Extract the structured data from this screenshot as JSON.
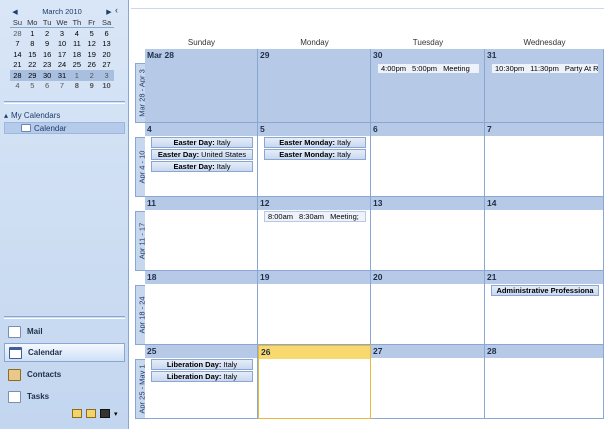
{
  "minical": {
    "title": "March 2010",
    "prev_icon": "◀",
    "next_icon": "▶",
    "dow": [
      "Su",
      "Mo",
      "Tu",
      "We",
      "Th",
      "Fr",
      "Sa"
    ],
    "weeks": [
      [
        "28",
        "1",
        "2",
        "3",
        "4",
        "5",
        "6"
      ],
      [
        "7",
        "8",
        "9",
        "10",
        "11",
        "12",
        "13"
      ],
      [
        "14",
        "15",
        "16",
        "17",
        "18",
        "19",
        "20"
      ],
      [
        "21",
        "22",
        "23",
        "24",
        "25",
        "26",
        "27"
      ],
      [
        "28",
        "29",
        "30",
        "31",
        "1",
        "2",
        "3"
      ],
      [
        "4",
        "5",
        "6",
        "7",
        "8",
        "9",
        "10"
      ]
    ]
  },
  "collapse_icon": "‹",
  "my_calendars": {
    "label": "My Calendars",
    "toggle_icon": "▴",
    "item": "Calendar"
  },
  "nav": {
    "mail": "Mail",
    "calendar": "Calendar",
    "contacts": "Contacts",
    "tasks": "Tasks"
  },
  "days": [
    "Sunday",
    "Monday",
    "Tuesday",
    "Wednesday"
  ],
  "weeks": [
    {
      "label": "Mar 28 - Apr 3",
      "dates": [
        "Mar 28",
        "29",
        "30",
        "31"
      ]
    },
    {
      "label": "Apr 4 - 10",
      "dates": [
        "4",
        "5",
        "6",
        "7"
      ]
    },
    {
      "label": "Apr 11 - 17",
      "dates": [
        "11",
        "12",
        "13",
        "14"
      ]
    },
    {
      "label": "Apr 18 - 24",
      "dates": [
        "18",
        "19",
        "20",
        "21"
      ]
    },
    {
      "label": "Apr 25 - May 1",
      "dates": [
        "25",
        "26",
        "27",
        "28"
      ]
    }
  ],
  "events": {
    "w0_tue": {
      "start": "4:00pm",
      "end": "5:00pm",
      "title": "Meeting"
    },
    "w0_wed": {
      "start": "10:30pm",
      "end": "11:30pm",
      "title": "Party At R"
    },
    "w1_sun": [
      {
        "name": "Easter Day:",
        "loc": "Italy"
      },
      {
        "name": "Easter Day:",
        "loc": "United States"
      },
      {
        "name": "Easter Day:",
        "loc": "Italy"
      }
    ],
    "w1_mon": [
      {
        "name": "Easter Monday:",
        "loc": "Italy"
      },
      {
        "name": "Easter Monday:",
        "loc": "Italy"
      }
    ],
    "w2_mon": {
      "start": "8:00am",
      "end": "8:30am",
      "title": "Meeting;"
    },
    "w3_wed": {
      "name": "Administrative Professiona"
    },
    "w4_sun": [
      {
        "name": "Liberation Day:",
        "loc": "Italy"
      },
      {
        "name": "Liberation Day:",
        "loc": "Italy"
      }
    ]
  }
}
